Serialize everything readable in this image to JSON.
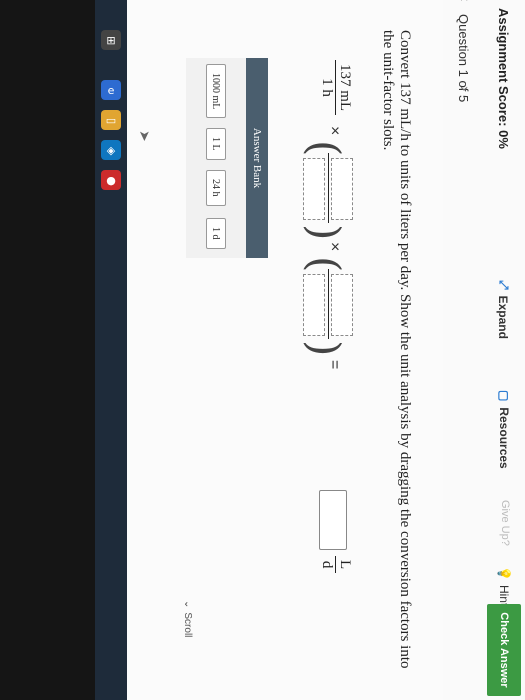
{
  "header": {
    "score": "Assignment Score: 0%",
    "expand": "Expand",
    "resources": "Resources",
    "give_up": "Give Up?",
    "hint": "Hint",
    "check_answer": "Check Answer"
  },
  "question_nav": {
    "label": "Question 1 of 5",
    "prev_glyph": "‹",
    "next_glyph": "›"
  },
  "problem": {
    "prompt": "Convert 137 mL/h to units of liters per day. Show the unit analysis by dragging the conversion factors into the unit-factor slots.",
    "given_numerator": "137 mL",
    "given_denominator": "1 h",
    "times": "×",
    "equals": "=",
    "result_unit_numerator": "L",
    "result_unit_denominator": "d"
  },
  "answer_bank": {
    "title": "Answer Bank",
    "items": [
      "1000 mL",
      "1 L",
      "24 h",
      "1 d"
    ]
  },
  "scroll_label": "Scroll",
  "icons": {
    "expand": "expand-icon",
    "resources": "resources-icon",
    "hint": "hint-icon",
    "scroll": "chevron-down-icon"
  },
  "colors": {
    "check_answer_bg": "#3c9a43",
    "bank_header_bg": "#4a5e6e"
  }
}
